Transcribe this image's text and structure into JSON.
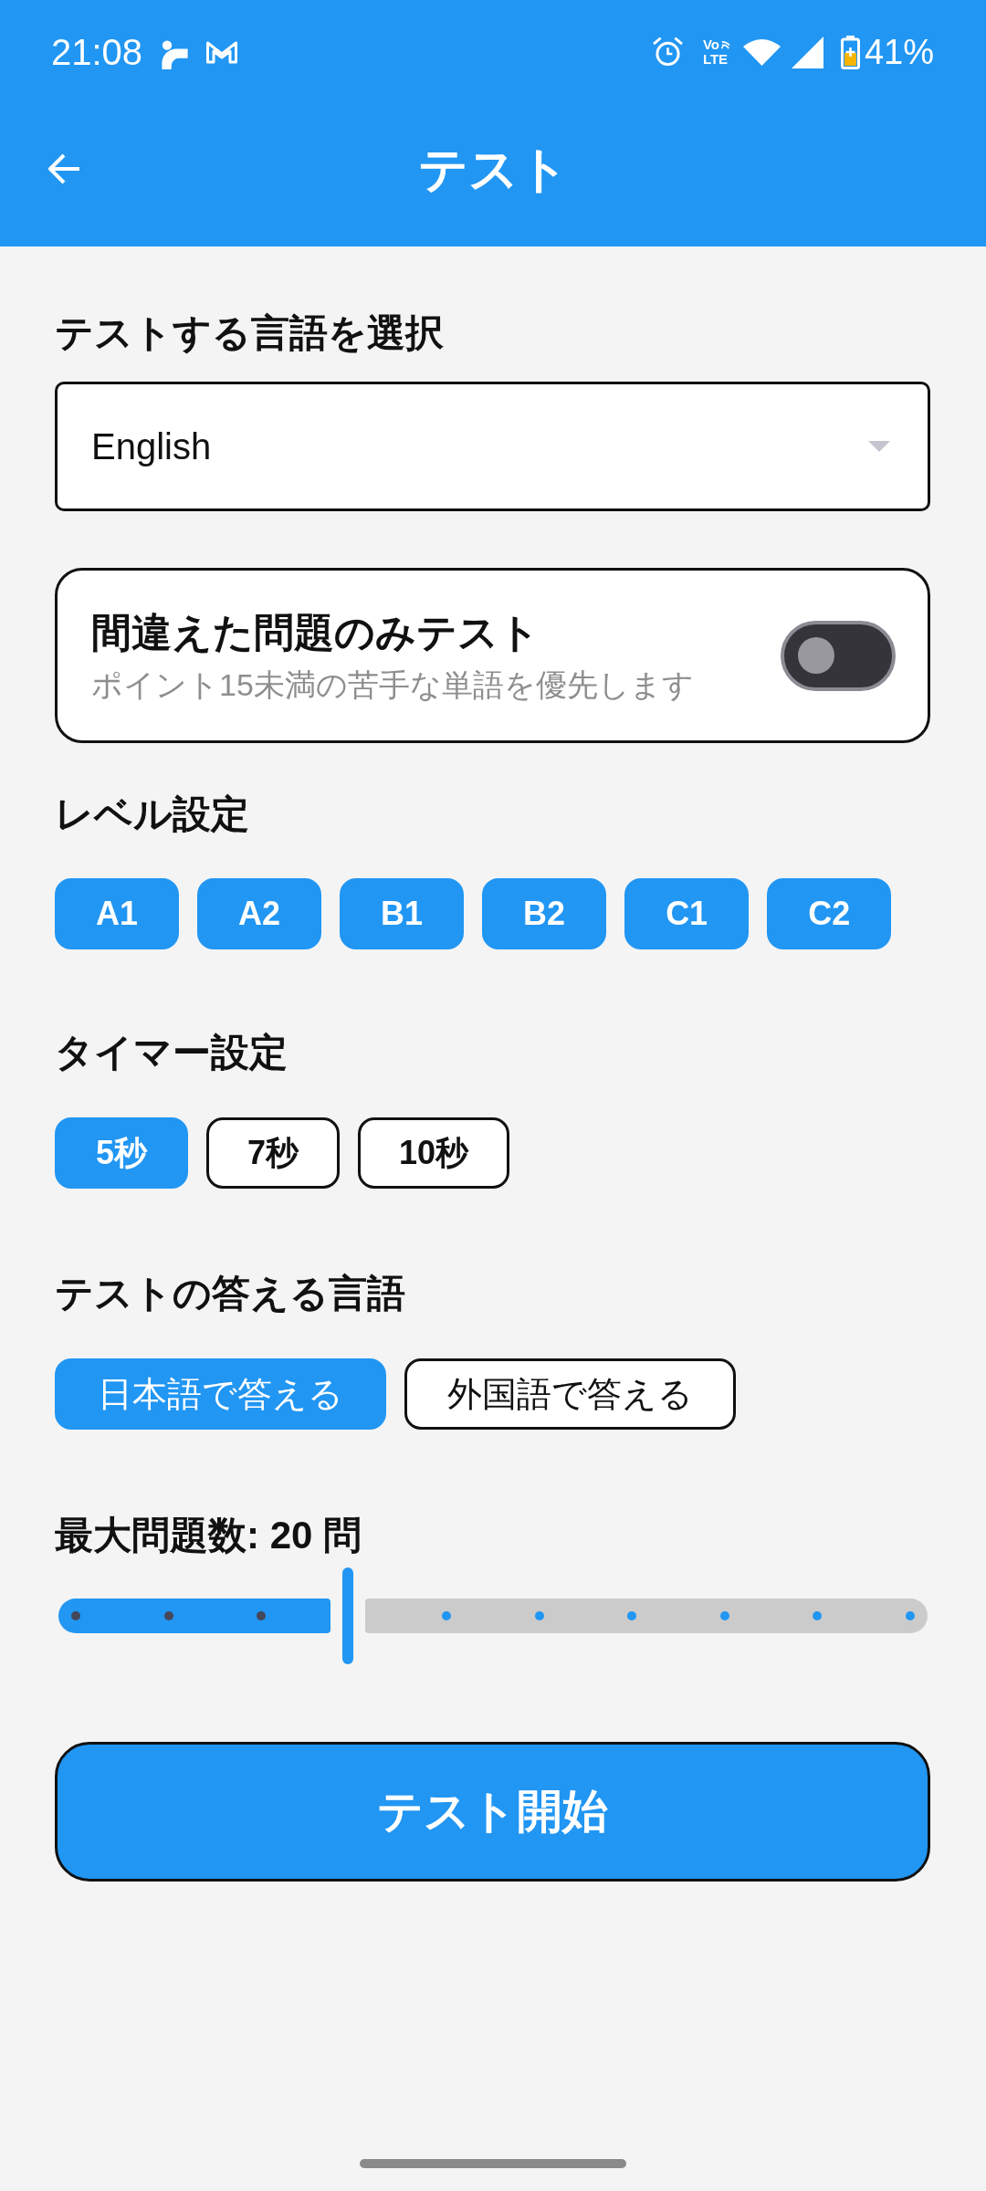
{
  "status_bar": {
    "time": "21:08",
    "volte": {
      "line_1": "Vo",
      "line_2": "LTE"
    },
    "battery": "41%"
  },
  "app_bar": {
    "title": "テスト"
  },
  "language_select": {
    "label": "テストする言語を選択",
    "value": "English"
  },
  "mistakes_only": {
    "title": "間違えた問題のみテスト",
    "subtitle": "ポイント15未満の苦手な単語を優先します",
    "on": false
  },
  "level_section": {
    "label": "レベル設定",
    "options": [
      {
        "label": "A1",
        "selected": true
      },
      {
        "label": "A2",
        "selected": true
      },
      {
        "label": "B1",
        "selected": true
      },
      {
        "label": "B2",
        "selected": true
      },
      {
        "label": "C1",
        "selected": true
      },
      {
        "label": "C2",
        "selected": true
      }
    ]
  },
  "timer_section": {
    "label": "タイマー設定",
    "options": [
      {
        "label": "5秒",
        "selected": true
      },
      {
        "label": "7秒",
        "selected": false
      },
      {
        "label": "10秒",
        "selected": false
      }
    ]
  },
  "answer_language": {
    "label": "テストの答える言語",
    "options": [
      {
        "label": "日本語で答える",
        "selected": true
      },
      {
        "label": "外国語で答える",
        "selected": false
      }
    ]
  },
  "max_questions": {
    "label": "最大問題数: 20 問",
    "level": 0.333
  },
  "start_button": {
    "label": "テスト開始"
  }
}
